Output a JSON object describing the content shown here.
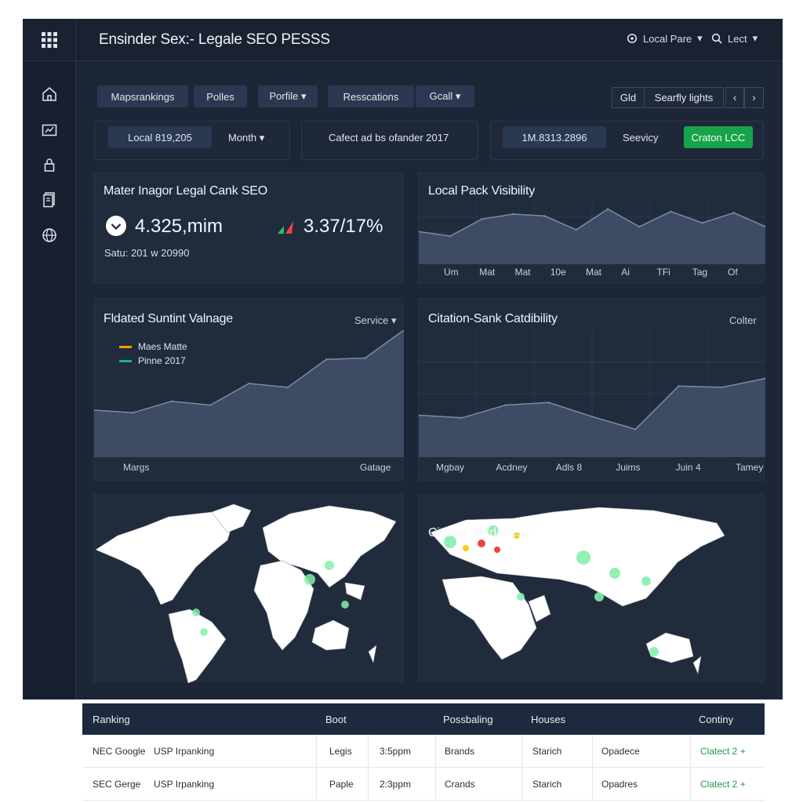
{
  "header": {
    "title": "Ensinder Sex:- Legale SEO PESSS",
    "links": [
      {
        "label": "Local Pare",
        "icon": "gear-icon"
      },
      {
        "label": "Lect",
        "icon": "search-icon"
      }
    ]
  },
  "sidebar": {
    "grid_icon": "apps-grid-icon",
    "items": [
      {
        "icon": "home-icon"
      },
      {
        "icon": "chart-icon"
      },
      {
        "icon": "lock-icon"
      },
      {
        "icon": "document-icon"
      },
      {
        "icon": "globe-icon"
      }
    ]
  },
  "toolbar": {
    "tabs": [
      "Mapsrankings",
      "Polles",
      "Porfile ▾",
      "Resscations",
      "Gcall ▾"
    ],
    "segments": [
      "Gld",
      "Searfly lights",
      "‹",
      "›"
    ]
  },
  "filters": {
    "local_value": "Local 819,205",
    "month_label": "Month ▾",
    "selected_text": "Cafect ad bs ofander 2017",
    "range_value": "1M.8313.2896",
    "service_label": "Seevicy",
    "green_button": "Craton LCC"
  },
  "cards": {
    "overview": {
      "title": "Mater Inagor Legal Cank SEO",
      "metric_main": "4.325,mim",
      "metric_change": "3.37/17%",
      "status": "Satu: 201 w 20990"
    },
    "local_pack": {
      "title": "Local Pack Visibility"
    },
    "fldated": {
      "title": "Fldated Suntint Valnage",
      "dropdown": "Service ▾",
      "x_left": "Margs",
      "x_right": "Gatage"
    },
    "citation_card": {
      "title": "Citation-Sank Catdibility",
      "link": "Colter"
    },
    "map_right": {
      "title": "Citation Terdariess"
    }
  },
  "chart_data": [
    {
      "type": "area",
      "x": [
        "Um",
        "Mat",
        "Mat",
        "10e",
        "Mat",
        "Ai",
        "TFi",
        "Tag",
        "Of"
      ],
      "values": [
        52,
        45,
        72,
        80,
        77,
        55,
        88,
        60,
        84,
        66,
        82,
        60
      ],
      "ylim": [
        0,
        100
      ],
      "grid": true
    },
    {
      "type": "area",
      "x": [
        "Margs",
        "Gatage"
      ],
      "series": [
        {
          "name": "Maes Matte",
          "color": "#f59e0b"
        },
        {
          "name": "Pinne 2017",
          "color": "#10b981"
        }
      ],
      "values": [
        37,
        35,
        44,
        41,
        58,
        55,
        77,
        78,
        100
      ],
      "ylim": [
        0,
        100
      ],
      "grid": false
    },
    {
      "type": "area",
      "x": [
        "Mgbay",
        "Acdney",
        "Adls 8",
        "Juims",
        "Juin 4",
        "Tamey"
      ],
      "values": [
        33,
        31,
        41,
        43,
        32,
        22,
        56,
        55,
        62
      ],
      "ylim": [
        0,
        100
      ],
      "grid": true
    }
  ],
  "table": {
    "headers": [
      "Ranking",
      "Boot",
      "Possbaling",
      "Houses",
      "Continy"
    ],
    "rows": [
      [
        "NEC Google",
        "USP Irpanking",
        "Legis",
        "3:5ppm",
        "Brands",
        "Starich",
        "Opadece",
        "Clatect 2 +"
      ],
      [
        "SEC Gerge",
        "USP Irpanking",
        "Paple",
        "2:3ppm",
        "Crands",
        "Starich",
        "Opadres",
        "Clatect 2 +"
      ]
    ]
  },
  "colors": {
    "background": "#1d2637",
    "card": "#202b3c",
    "accent_green": "#17a34a",
    "area_fill": "#3d4b65",
    "area_line": "#7d8ca6",
    "positive": "#22c55e",
    "negative": "#ef4444",
    "land": "#ffffff",
    "hot_land": "#86efac"
  }
}
